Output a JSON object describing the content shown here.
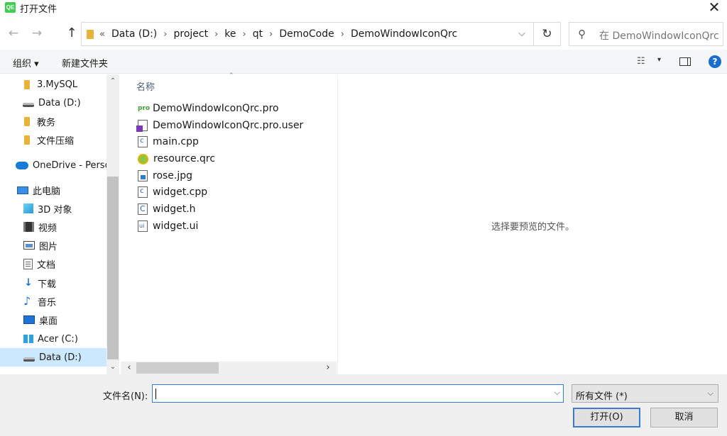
{
  "window": {
    "title": "打开文件",
    "logo_text": "QE",
    "close_glyph": "✕"
  },
  "nav": {
    "back_glyph": "←",
    "forward_glyph": "→",
    "up_glyph": "↑"
  },
  "address": {
    "prefix_glyph": "«",
    "crumbs": [
      "Data (D:)",
      "project",
      "ke",
      "qt",
      "DemoCode",
      "DemoWindowIconQrc"
    ],
    "sep_glyph": "›",
    "dropdown_glyph": "⌵",
    "refresh_glyph": "↻"
  },
  "search": {
    "placeholder": "在 DemoWindowIconQrc ..."
  },
  "toolbar": {
    "organize": "组织 ▾",
    "new_folder": "新建文件夹",
    "view_icon_glyph": "☷",
    "view_dd_glyph": "▾",
    "help_glyph": "?"
  },
  "sidebar": {
    "items": [
      {
        "label": "3.MySQL",
        "icon": "folder-icon"
      },
      {
        "label": "Data (D:)",
        "icon": "drive-icon"
      },
      {
        "label": "教务",
        "icon": "folder-icon"
      },
      {
        "label": "文件压缩",
        "icon": "folder-icon"
      },
      {
        "label": "OneDrive - Perso",
        "icon": "onedrive-icon"
      },
      {
        "label": "此电脑",
        "icon": "computer-icon"
      },
      {
        "label": "3D 对象",
        "icon": "3d-objects-icon"
      },
      {
        "label": "视频",
        "icon": "video-icon"
      },
      {
        "label": "图片",
        "icon": "pictures-icon"
      },
      {
        "label": "文档",
        "icon": "documents-icon"
      },
      {
        "label": "下载",
        "icon": "download-icon"
      },
      {
        "label": "音乐",
        "icon": "music-icon"
      },
      {
        "label": "桌面",
        "icon": "desktop-icon"
      },
      {
        "label": "Acer (C:)",
        "icon": "windows-drive-icon"
      },
      {
        "label": "Data (D:)",
        "icon": "drive-icon",
        "selected": true
      }
    ],
    "scroll_up_glyph": "⌃",
    "scroll_down_glyph": "⌄"
  },
  "files": {
    "column_header": "名称",
    "sort_glyph": "⌃",
    "items": [
      {
        "name": "DemoWindowIconQrc.pro",
        "icon": "qt-pro-icon",
        "glyph": "pro"
      },
      {
        "name": "DemoWindowIconQrc.pro.user",
        "icon": "visual-studio-user-icon"
      },
      {
        "name": "main.cpp",
        "icon": "cpp-file-icon"
      },
      {
        "name": "resource.qrc",
        "icon": "qrc-file-icon"
      },
      {
        "name": "rose.jpg",
        "icon": "image-file-icon"
      },
      {
        "name": "widget.cpp",
        "icon": "cpp-file-icon"
      },
      {
        "name": "widget.h",
        "icon": "header-file-icon"
      },
      {
        "name": "widget.ui",
        "icon": "ui-file-icon"
      }
    ],
    "hscroll_left_glyph": "‹",
    "hscroll_right_glyph": "›"
  },
  "preview": {
    "message": "选择要预览的文件。"
  },
  "footer": {
    "filename_label": "文件名(N):",
    "filename_value": "",
    "filename_dd_glyph": "⌵",
    "filetype_value": "所有文件 (*)",
    "filetype_dd_glyph": "⌵",
    "open_button": "打开(O)",
    "cancel_button": "取消"
  }
}
